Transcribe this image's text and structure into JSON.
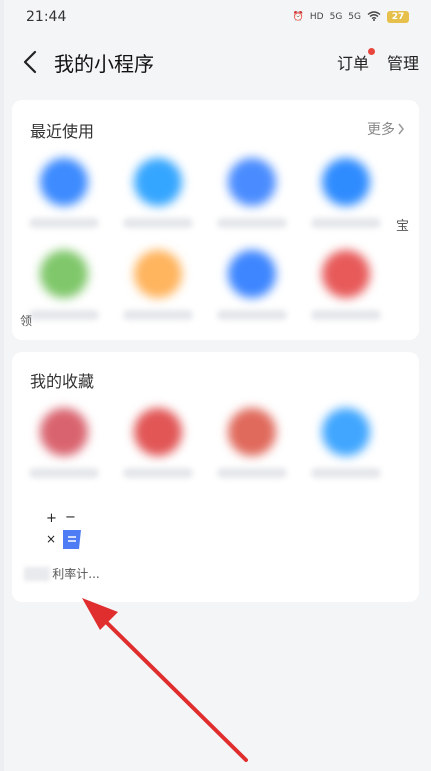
{
  "status": {
    "time": "21:44",
    "battery": "27",
    "net1": "HD",
    "net2": "5G",
    "net3": "5G"
  },
  "header": {
    "title": "我的小程序",
    "orders": "订单",
    "manage": "管理"
  },
  "recent": {
    "title": "最近使用",
    "more": "更多",
    "apps": [
      {
        "color": "#3d8bff"
      },
      {
        "color": "#35a6ff"
      },
      {
        "color": "#4a8cff"
      },
      {
        "color": "#2f8cff"
      },
      {
        "color": "#7fc76a"
      },
      {
        "color": "#ffb45e"
      },
      {
        "color": "#3e86ff"
      },
      {
        "color": "#e85a5a"
      }
    ],
    "edge_left_text": "领",
    "edge_right_text": "宝"
  },
  "favorites": {
    "title": "我的收藏",
    "apps": [
      {
        "color": "#d9646f"
      },
      {
        "color": "#e25656"
      },
      {
        "color": "#e06a5c"
      },
      {
        "color": "#40a6ff"
      }
    ],
    "calc": {
      "label": "利率计...",
      "icon_name": "calculator-icon",
      "accent": "#4d7cf5"
    }
  },
  "annotation": {
    "arrow_color": "#e02d2d"
  }
}
